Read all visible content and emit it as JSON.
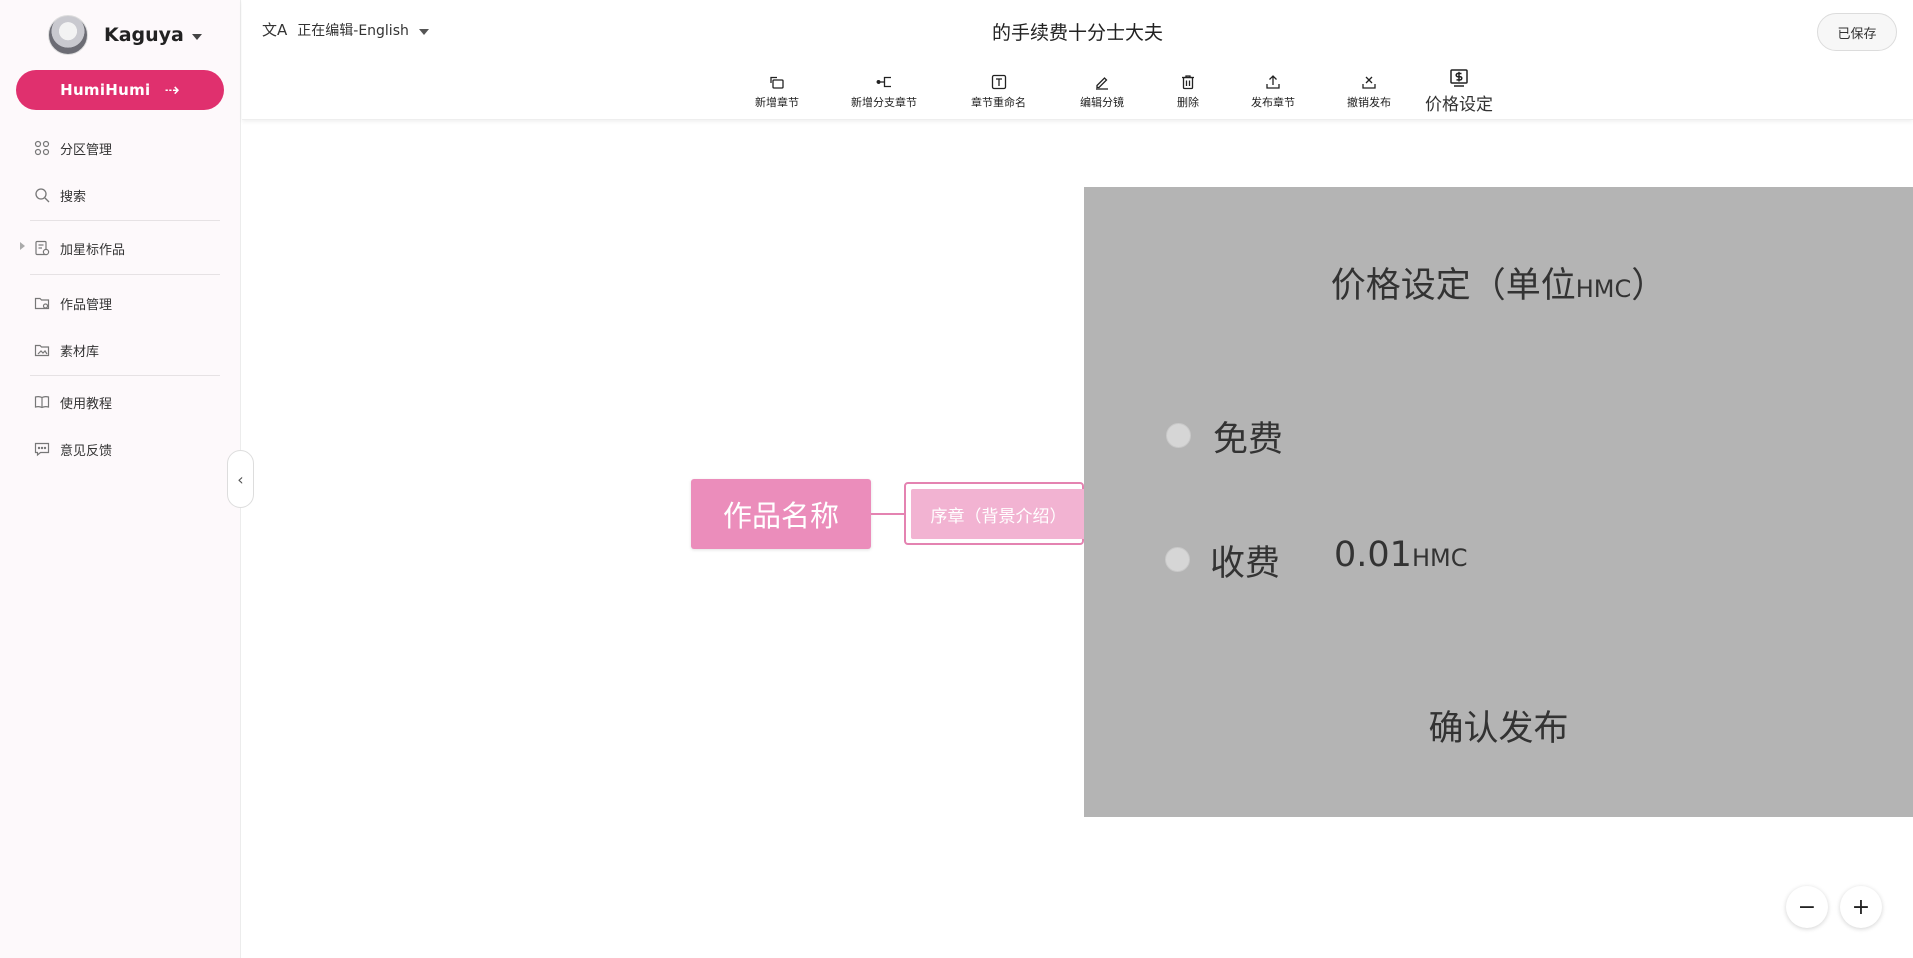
{
  "sidebar": {
    "user_name": "Kaguya",
    "primary_button": "HumiHumi",
    "primary_arrow": "⇢",
    "items": [
      {
        "label": "分区管理",
        "icon": "grid-icon"
      },
      {
        "label": "搜索",
        "icon": "search-icon"
      },
      {
        "label": "加星标作品",
        "icon": "starred-doc-icon"
      },
      {
        "label": "作品管理",
        "icon": "folder-icon"
      },
      {
        "label": "素材库",
        "icon": "image-folder-icon"
      },
      {
        "label": "使用教程",
        "icon": "book-icon"
      },
      {
        "label": "意见反馈",
        "icon": "feedback-icon"
      }
    ],
    "collapse_glyph": "‹"
  },
  "header": {
    "lang_icon": "文A",
    "edit_language": "正在编辑-English",
    "title": "的手续费十分士大夫",
    "save_status": "已保存"
  },
  "toolbar": {
    "items": [
      {
        "label": "新增章节",
        "icon": "add-chapter-icon"
      },
      {
        "label": "新增分支章节",
        "icon": "add-branch-icon"
      },
      {
        "label": "章节重命名",
        "icon": "rename-icon"
      },
      {
        "label": "编辑分镜",
        "icon": "edit-icon"
      },
      {
        "label": "删除",
        "icon": "trash-icon"
      },
      {
        "label": "发布章节",
        "icon": "upload-icon"
      },
      {
        "label": "撤销发布",
        "icon": "unpublish-icon"
      },
      {
        "label": "价格设定",
        "icon": "price-icon"
      }
    ]
  },
  "canvas": {
    "root_node": "作品名称",
    "child_node": "序章（背景介绍）"
  },
  "price_panel": {
    "title": "价格设定（单位",
    "title_unit": "HMC",
    "title_close": "）",
    "option_free": "免费",
    "option_paid": "收费",
    "price_value": "0.01",
    "price_unit": "HMC",
    "confirm": "确认发布"
  },
  "zoom": {
    "out": "−",
    "in": "+"
  },
  "colors": {
    "accent": "#e0306e",
    "root_node": "#eb8dbb",
    "child_node": "#f2b3d2",
    "panel_bg": "#b4b4b4"
  }
}
